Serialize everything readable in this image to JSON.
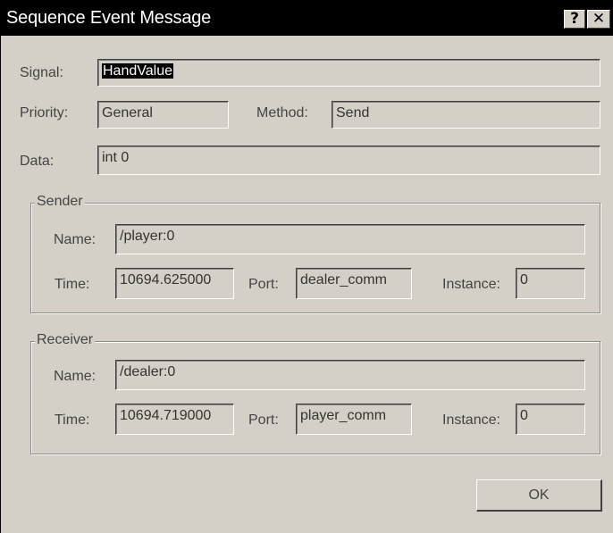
{
  "window": {
    "title": "Sequence Event Message",
    "help_glyph": "?",
    "close_glyph": "✕"
  },
  "message": {
    "signal_label": "Signal:",
    "signal_value": "HandValue",
    "priority_label": "Priority:",
    "priority_value": "General",
    "method_label": "Method:",
    "method_value": "Send",
    "data_label": "Data:",
    "data_value": "int 0"
  },
  "sender": {
    "group_title": "Sender",
    "name_label": "Name:",
    "name_value": "/player:0",
    "time_label": "Time:",
    "time_value": "10694.625000",
    "port_label": "Port:",
    "port_value": "dealer_comm",
    "instance_label": "Instance:",
    "instance_value": "0"
  },
  "receiver": {
    "group_title": "Receiver",
    "name_label": "Name:",
    "name_value": "/dealer:0",
    "time_label": "Time:",
    "time_value": "10694.719000",
    "port_label": "Port:",
    "port_value": "player_comm",
    "instance_label": "Instance:",
    "instance_value": "0"
  },
  "buttons": {
    "ok_label": "OK"
  },
  "colors": {
    "dialog_face": "#d4d0c8",
    "titlebar": "#000000",
    "selection": "#000000"
  }
}
